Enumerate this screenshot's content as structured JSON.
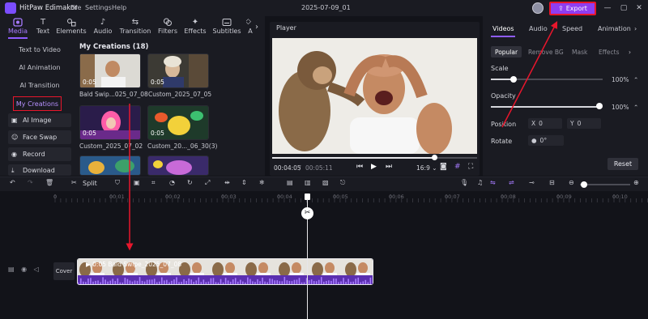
{
  "titlebar": {
    "app_title": "HitPaw Edimakor",
    "menu": [
      "File",
      "Settings",
      "Help"
    ],
    "project_name": "2025-07-09_01",
    "export_label": "Export",
    "export_color": "#8f3df2",
    "highlight_color": "#e8162c"
  },
  "tool_tabs": [
    "Media",
    "Text",
    "Elements",
    "Audio",
    "Transition",
    "Filters",
    "Effects",
    "Subtitles",
    "A"
  ],
  "side_items": [
    "Text to Video",
    "AI Animation",
    "AI Transition",
    "My Creations"
  ],
  "side_buttons": [
    "AI Image",
    "Face Swap",
    "Record",
    "Download"
  ],
  "creations": {
    "title": "My Creations (18)",
    "items": [
      {
        "label": "Bald Swip...025_07_08",
        "duration": "0:05"
      },
      {
        "label": "Custom_2025_07_05",
        "duration": "0:05"
      },
      {
        "label": "Custom_2025_07_02",
        "duration": "0:05"
      },
      {
        "label": "Custom_20..._06_30(3)",
        "duration": "0:05"
      }
    ]
  },
  "player": {
    "label": "Player",
    "current_time": "00:04:05",
    "separator": "/",
    "total_time": "00:05:11",
    "progress": 0.79,
    "aspect": "16:9"
  },
  "right_panel": {
    "tabs": [
      "Videos",
      "Audio",
      "Speed",
      "Animation"
    ],
    "subtabs": [
      "Popular",
      "Remove BG",
      "Mask",
      "Effects"
    ],
    "scale_label": "Scale",
    "scale_value": "100%",
    "opacity_label": "Opacity",
    "opacity_value": "100%",
    "position_label": "Position",
    "pos_x_label": "X",
    "pos_x": "0",
    "pos_y_label": "Y",
    "pos_y": "0",
    "rotate_label": "Rotate",
    "rotate_value": "0°",
    "reset_label": "Reset"
  },
  "toolbar": {
    "split_label": "Split"
  },
  "timeline": {
    "ticks": [
      "0",
      "00:01",
      "00:02",
      "00:03",
      "00:04",
      "00:05",
      "00:06",
      "00:07",
      "00:08",
      "00:09",
      "00:10"
    ],
    "cover_label": "Cover",
    "clip_label": "0:05 Bald Swipe_2025_07_08"
  }
}
